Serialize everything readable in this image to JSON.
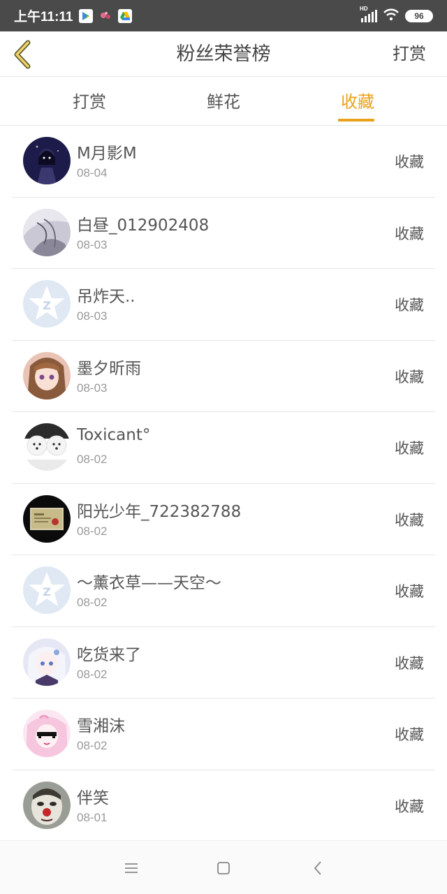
{
  "status_bar": {
    "time": "上午11:11",
    "battery": "96",
    "network": "HD"
  },
  "header": {
    "title": "粉丝荣誉榜",
    "action": "打赏"
  },
  "tabs": [
    {
      "label": "打赏",
      "active": false
    },
    {
      "label": "鲜花",
      "active": false
    },
    {
      "label": "收藏",
      "active": true
    }
  ],
  "fans": [
    {
      "name": "M月影M",
      "date": "08-04",
      "type": "收藏",
      "avatar": "dark-anime-avatar"
    },
    {
      "name": "白昼_012902408",
      "date": "08-03",
      "type": "收藏",
      "avatar": "grey-sketch-avatar"
    },
    {
      "name": "吊炸天..",
      "date": "08-03",
      "type": "收藏",
      "avatar": "default-qq-avatar"
    },
    {
      "name": "墨夕昕雨",
      "date": "08-03",
      "type": "收藏",
      "avatar": "anime-girl-avatar"
    },
    {
      "name": "Toxicant°",
      "date": "08-02",
      "type": "收藏",
      "avatar": "white-dogs-avatar"
    },
    {
      "name": "阳光少年_722382788",
      "date": "08-02",
      "type": "收藏",
      "avatar": "certificate-avatar"
    },
    {
      "name": "～薰衣草——天空～",
      "date": "08-02",
      "type": "收藏",
      "avatar": "default-qq-avatar"
    },
    {
      "name": "吃货来了",
      "date": "08-02",
      "type": "收藏",
      "avatar": "white-hair-anime-avatar"
    },
    {
      "name": "雪湘沫",
      "date": "08-02",
      "type": "收藏",
      "avatar": "sunglasses-anime-avatar"
    },
    {
      "name": "伴笑",
      "date": "08-01",
      "type": "收藏",
      "avatar": "clown-face-avatar"
    }
  ],
  "colors": {
    "accent": "#e8a21c",
    "status_bar": "#4a4a4a",
    "divider": "#e6e6e6"
  }
}
